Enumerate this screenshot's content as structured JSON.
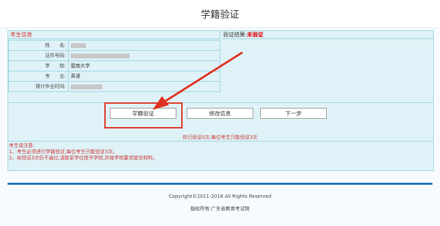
{
  "page": {
    "title": "学籍验证"
  },
  "candidate": {
    "section_title": "考生信息",
    "fields": [
      {
        "label": "姓　　名:",
        "value": ""
      },
      {
        "label": "证件号码:",
        "value": ""
      },
      {
        "label": "学　　校:",
        "value": "暨南大学"
      },
      {
        "label": "专　　业:",
        "value": "英语"
      },
      {
        "label": "预计毕业时间:",
        "value": ""
      }
    ]
  },
  "result": {
    "label": "验证结果:",
    "status": "未验证"
  },
  "buttons": {
    "verify": "学籍验证",
    "edit": "修改信息",
    "next": "下一步"
  },
  "verify_count_text": "你已验证0次,每位考生只能验证3次",
  "notice": {
    "title": "考生请注意:",
    "lines": [
      "1、考生必须进行学籍验证,每位考生只能验证3次。",
      "2、如验证3次仍不通过,请联系学位授予学校,并按学校要求提交材料。"
    ]
  },
  "footer": {
    "copyright": "Copyright©2011-2018 All Rights Reserved",
    "owner": "版权所有:广东省教育考试院"
  },
  "colors": {
    "accent": "#e0301e",
    "panel": "#dff2f7",
    "border": "#9fd6e4",
    "bar": "#1f74b8"
  }
}
